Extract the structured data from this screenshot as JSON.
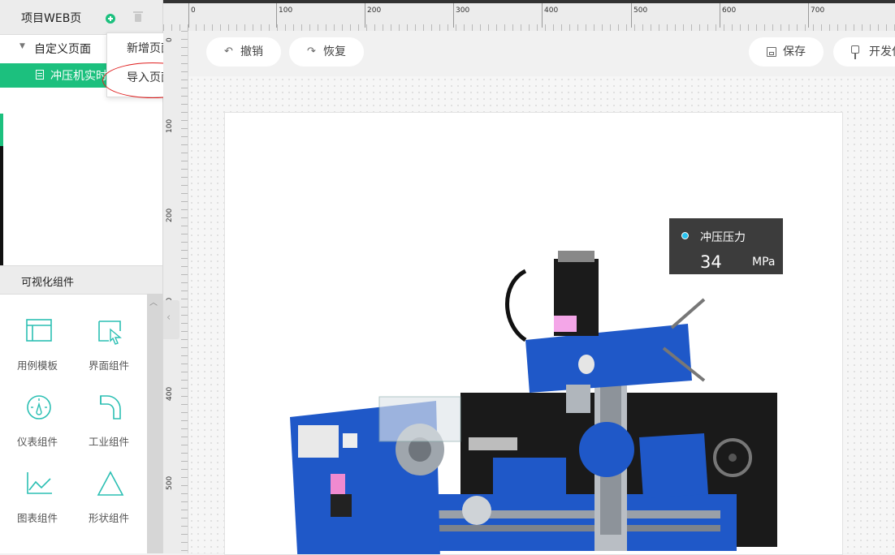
{
  "project_panel": {
    "title": "项目WEB页",
    "tree": {
      "parent_label": "自定义页面",
      "child_label": "冲压机实时监控"
    }
  },
  "context_menu": {
    "new_page": "新增页面",
    "import_page": "导入页面"
  },
  "components": {
    "title": "可视化组件",
    "items": [
      {
        "label": "用例模板",
        "icon": "template-icon"
      },
      {
        "label": "界面组件",
        "icon": "ui-component-icon"
      },
      {
        "label": "仪表组件",
        "icon": "gauge-icon"
      },
      {
        "label": "工业组件",
        "icon": "pipe-icon"
      },
      {
        "label": "图表组件",
        "icon": "line-chart-icon"
      },
      {
        "label": "形状组件",
        "icon": "triangle-icon"
      }
    ]
  },
  "ruler": {
    "top_ticks": [
      "0",
      "100",
      "200",
      "300",
      "400",
      "500",
      "600",
      "700"
    ],
    "left_ticks": [
      "0",
      "100",
      "200",
      "300",
      "400",
      "500"
    ]
  },
  "toolbar": {
    "undo": "撤销",
    "redo": "恢复",
    "save": "保存",
    "develop": "开发任务"
  },
  "data_tag": {
    "name": "冲压压力",
    "value": "34",
    "unit": "MPa"
  },
  "colors": {
    "accent": "#1cc07e",
    "highlight": "#e02020",
    "tag_bg": "#3c3c3c",
    "machine_blue": "#1f58c8"
  }
}
